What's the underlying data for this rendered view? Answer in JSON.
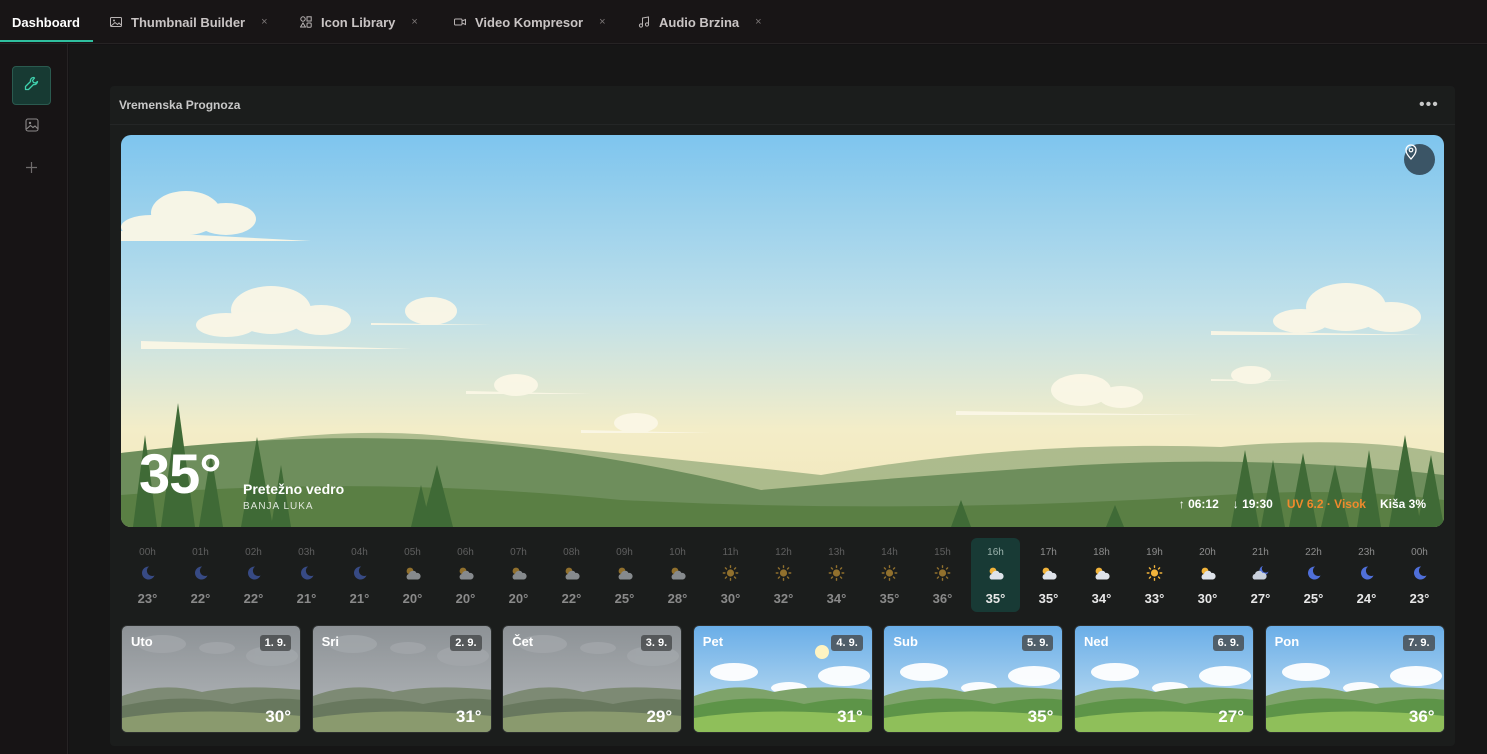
{
  "tabs": [
    {
      "label": "Dashboard",
      "icon": "none",
      "closable": false
    },
    {
      "label": "Thumbnail Builder",
      "icon": "image-icon",
      "closable": true
    },
    {
      "label": "Icon Library",
      "icon": "shapes-icon",
      "closable": true
    },
    {
      "label": "Video Kompresor",
      "icon": "video-icon",
      "closable": true
    },
    {
      "label": "Audio Brzina",
      "icon": "music-note-icon",
      "closable": true
    }
  ],
  "tab_close_glyph": "×",
  "rail": {
    "items": [
      "wrench-icon",
      "image-icon",
      "plus-icon"
    ]
  },
  "panel": {
    "title": "Vremenska Prognoza",
    "menu": "•••"
  },
  "hero": {
    "temperature": "35°",
    "condition": "Pretežno vedro",
    "city": "BANJA LUKA",
    "sunrise": "↑ 06:12",
    "sunset": "↓ 19:30",
    "uv": "UV 6.2 · Visok",
    "rain": "Kiša 3%"
  },
  "hourly": [
    {
      "time": "00h",
      "icon": "moon",
      "temp": "23°"
    },
    {
      "time": "01h",
      "icon": "moon",
      "temp": "22°"
    },
    {
      "time": "02h",
      "icon": "moon",
      "temp": "22°"
    },
    {
      "time": "03h",
      "icon": "moon",
      "temp": "21°"
    },
    {
      "time": "04h",
      "icon": "moon",
      "temp": "21°"
    },
    {
      "time": "05h",
      "icon": "cloud-sun",
      "temp": "20°"
    },
    {
      "time": "06h",
      "icon": "cloud-sun",
      "temp": "20°"
    },
    {
      "time": "07h",
      "icon": "cloud-sun",
      "temp": "20°"
    },
    {
      "time": "08h",
      "icon": "cloud-sun",
      "temp": "22°"
    },
    {
      "time": "09h",
      "icon": "cloud-sun",
      "temp": "25°"
    },
    {
      "time": "10h",
      "icon": "cloud-sun",
      "temp": "28°"
    },
    {
      "time": "11h",
      "icon": "sun",
      "temp": "30°"
    },
    {
      "time": "12h",
      "icon": "sun",
      "temp": "32°"
    },
    {
      "time": "13h",
      "icon": "sun",
      "temp": "34°"
    },
    {
      "time": "14h",
      "icon": "sun",
      "temp": "35°"
    },
    {
      "time": "15h",
      "icon": "sun",
      "temp": "36°"
    },
    {
      "time": "16h",
      "icon": "cloud-sun",
      "temp": "35°"
    },
    {
      "time": "17h",
      "icon": "cloud-sun",
      "temp": "35°"
    },
    {
      "time": "18h",
      "icon": "cloud-sun",
      "temp": "34°"
    },
    {
      "time": "19h",
      "icon": "sun",
      "temp": "33°"
    },
    {
      "time": "20h",
      "icon": "cloud-sun",
      "temp": "30°"
    },
    {
      "time": "21h",
      "icon": "cloud-moon",
      "temp": "27°"
    },
    {
      "time": "22h",
      "icon": "moon",
      "temp": "25°"
    },
    {
      "time": "23h",
      "icon": "moon",
      "temp": "24°"
    },
    {
      "time": "00h",
      "icon": "moon",
      "temp": "23°"
    }
  ],
  "current_hour_index": 16,
  "daily": [
    {
      "day": "Uto",
      "date": "1. 9.",
      "temp": "30°",
      "sky": "overcast"
    },
    {
      "day": "Sri",
      "date": "2. 9.",
      "temp": "31°",
      "sky": "overcast"
    },
    {
      "day": "Čet",
      "date": "3. 9.",
      "temp": "29°",
      "sky": "overcast"
    },
    {
      "day": "Pet",
      "date": "4. 9.",
      "temp": "31°",
      "sky": "sunny"
    },
    {
      "day": "Sub",
      "date": "5. 9.",
      "temp": "35°",
      "sky": "sunny"
    },
    {
      "day": "Ned",
      "date": "6. 9.",
      "temp": "27°",
      "sky": "sunny"
    },
    {
      "day": "Pon",
      "date": "7. 9.",
      "temp": "36°",
      "sky": "sunny"
    }
  ],
  "colors": {
    "accent": "#2fbf9f",
    "uv_warning": "#f08a2c",
    "current_hour_bg": "#183a35"
  }
}
